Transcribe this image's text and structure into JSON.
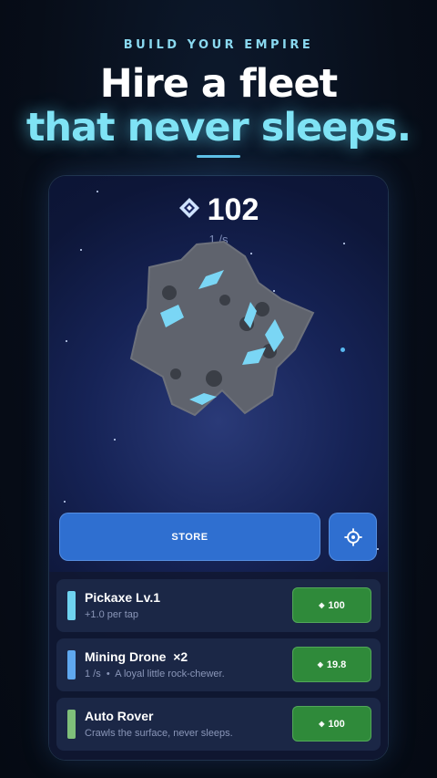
{
  "header": {
    "eyebrow": "BUILD YOUR EMPIRE",
    "headline_line1": "Hire a fleet",
    "headline_line2": "that never sleeps."
  },
  "game": {
    "score": "102",
    "rate": "1 /s",
    "currency_icon": "gem-icon",
    "store_label": "STORE",
    "settings_icon": "gear-icon"
  },
  "upgrades": [
    {
      "name": "Pickaxe Lv.1",
      "desc": "+1.0 per tap",
      "price": "100",
      "color": "#6fd3f0"
    },
    {
      "name": "Mining Drone  ×2",
      "desc": "1 /s  •  A loyal little rock-chewer.",
      "price": "19.8",
      "color": "#5fa8ef"
    },
    {
      "name": "Auto Rover",
      "desc": "Crawls the surface, never sleeps.",
      "price": "100",
      "color": "#7fbf7a"
    }
  ],
  "colors": {
    "accent": "#7fe3f5",
    "button_blue": "#2f6fd0",
    "buy_green": "#2f8a3a"
  }
}
